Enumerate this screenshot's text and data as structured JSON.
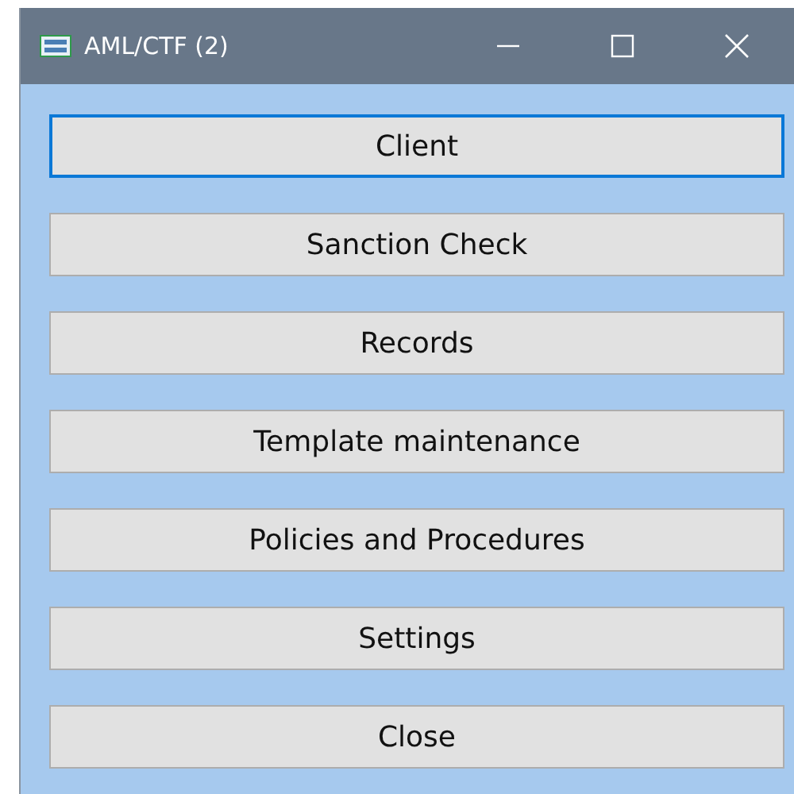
{
  "window": {
    "title": "AML/CTF (2)"
  },
  "buttons": [
    {
      "label": "Client",
      "focused": true
    },
    {
      "label": "Sanction Check",
      "focused": false
    },
    {
      "label": "Records",
      "focused": false
    },
    {
      "label": "Template maintenance",
      "focused": false
    },
    {
      "label": "Policies and Procedures",
      "focused": false
    },
    {
      "label": "Settings",
      "focused": false
    },
    {
      "label": "Close",
      "focused": false
    }
  ]
}
